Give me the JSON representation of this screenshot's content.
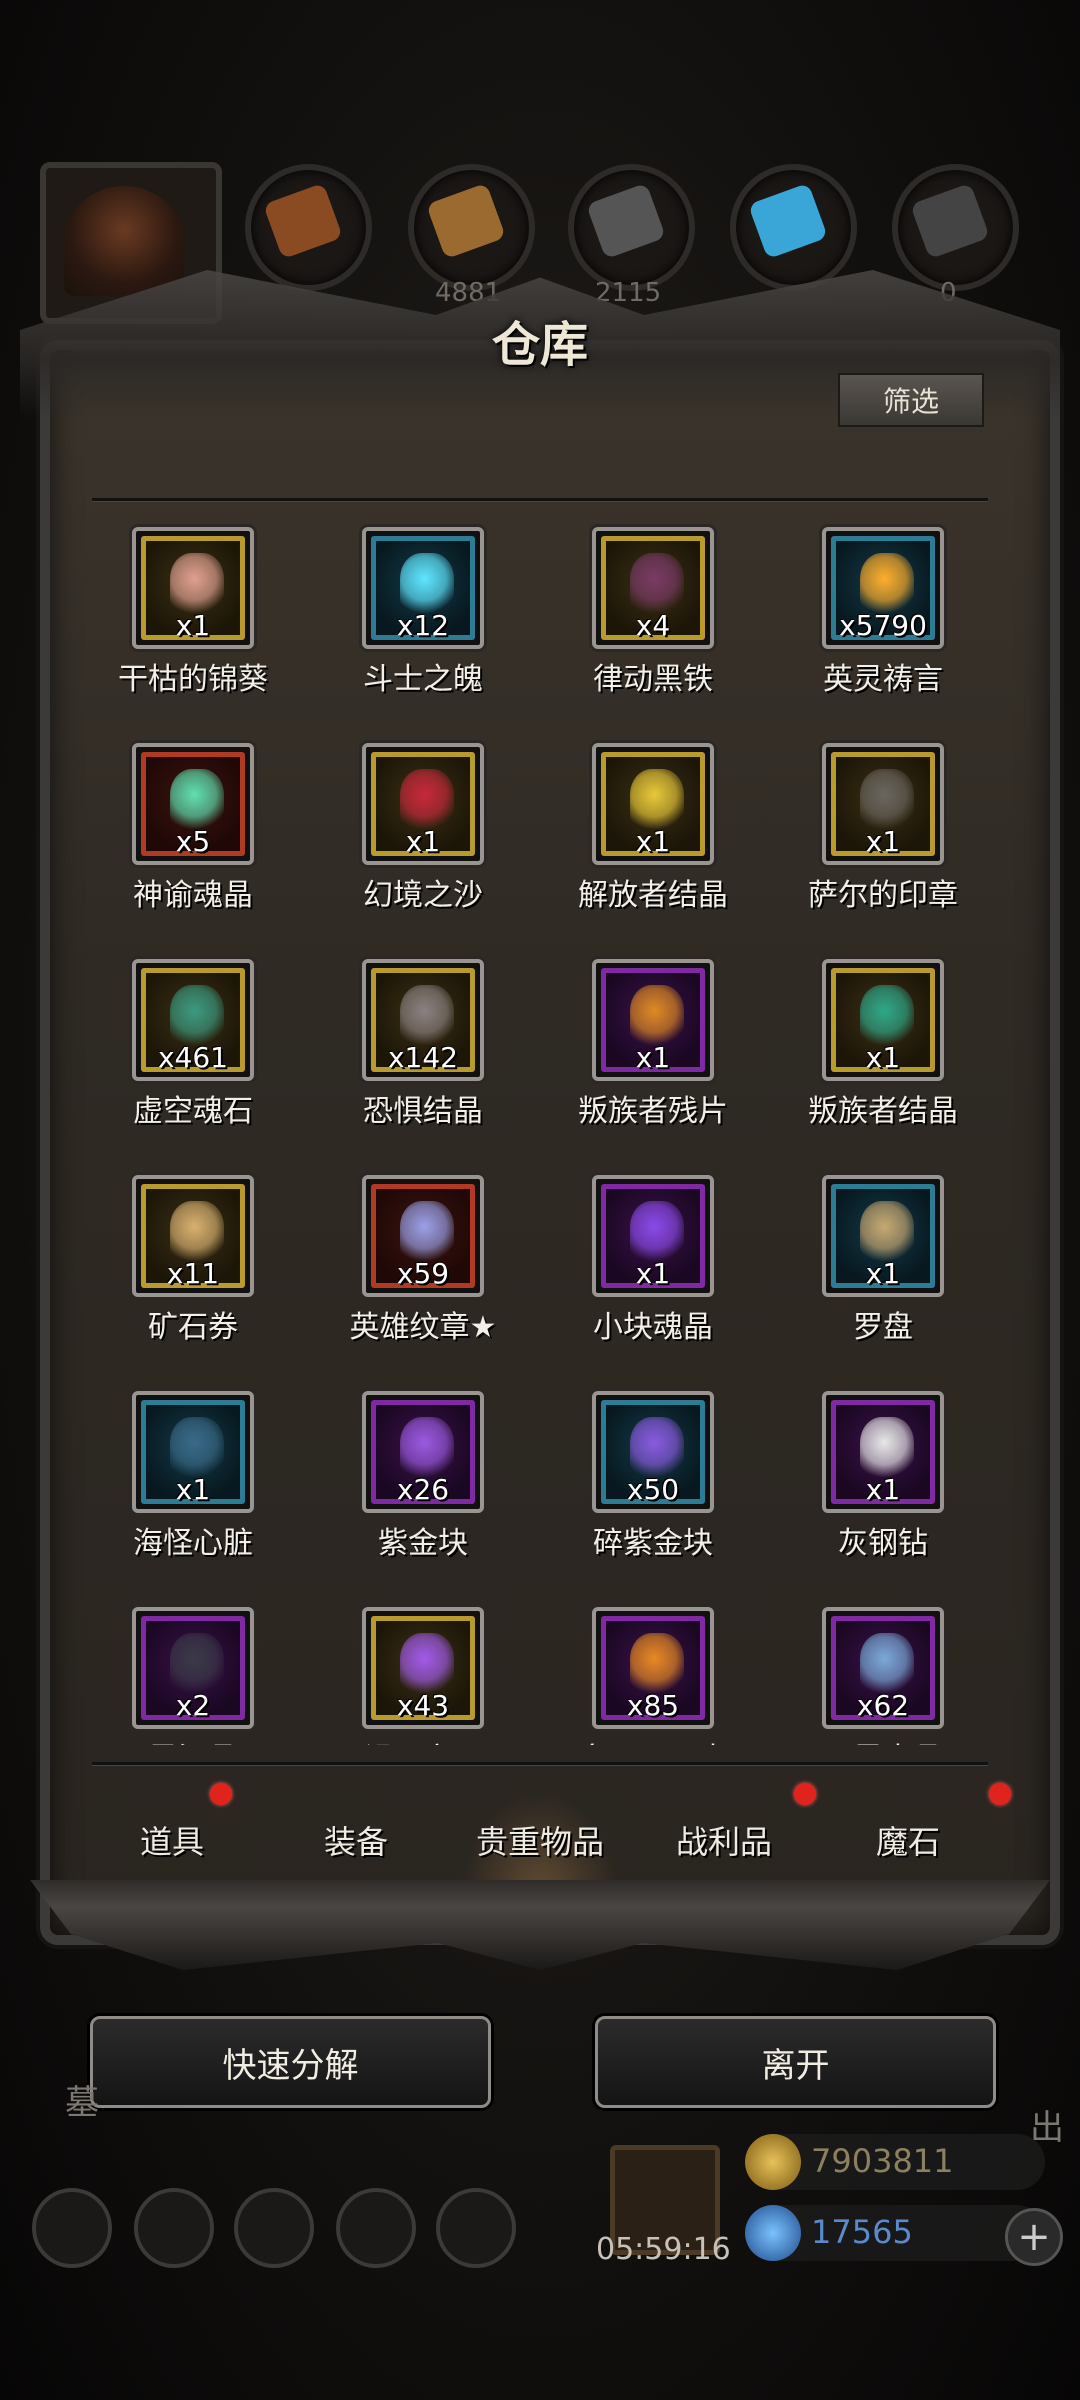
{
  "panel": {
    "title": "仓库",
    "filter_label": "筛选"
  },
  "resources": [
    {
      "icon": "wood-log-icon",
      "color": "#8a4a22",
      "count": ""
    },
    {
      "icon": "plank-icon",
      "color": "#9a6a30",
      "count": "4881"
    },
    {
      "icon": "iron-ingot-icon",
      "color": "#555555",
      "count": "2115"
    },
    {
      "icon": "crystal-icon",
      "color": "#3aa6d8",
      "count": ""
    },
    {
      "icon": "stone-icon",
      "color": "#444444",
      "count": "0"
    }
  ],
  "items": [
    {
      "name": "干枯的锦葵",
      "count": "x1",
      "rarity": "gold",
      "icon": "flower-icon",
      "color": "#e0a090"
    },
    {
      "name": "斗士之魄",
      "count": "x12",
      "rarity": "blue",
      "icon": "spirit-orb-icon",
      "color": "#5fe6ff"
    },
    {
      "name": "律动黑铁",
      "count": "x4",
      "rarity": "gold",
      "icon": "black-iron-icon",
      "color": "#7a3a66"
    },
    {
      "name": "英灵祷言",
      "count": "x5790",
      "rarity": "blue",
      "icon": "fire-orb-icon",
      "color": "#ffae2a"
    },
    {
      "name": "神谕魂晶",
      "count": "x5",
      "rarity": "red",
      "icon": "green-crystal-icon",
      "color": "#5fe0b0"
    },
    {
      "name": "幻境之沙",
      "count": "x1",
      "rarity": "gold",
      "icon": "red-sand-icon",
      "color": "#c8283a"
    },
    {
      "name": "解放者结晶",
      "count": "x1",
      "rarity": "gold",
      "icon": "gold-shard-icon",
      "color": "#e8c838"
    },
    {
      "name": "萨尔的印章",
      "count": "x1",
      "rarity": "gold",
      "icon": "shield-seal-icon",
      "color": "#6a665f"
    },
    {
      "name": "虚空魂石",
      "count": "x461",
      "rarity": "gold",
      "icon": "void-stone-icon",
      "color": "#3a9a80"
    },
    {
      "name": "恐惧结晶",
      "count": "x142",
      "rarity": "gold",
      "icon": "fear-crystal-icon",
      "color": "#8a8080"
    },
    {
      "name": "叛族者残片",
      "count": "x1",
      "rarity": "purple",
      "icon": "shard-fragment-icon",
      "color": "#e08a22"
    },
    {
      "name": "叛族者结晶",
      "count": "x1",
      "rarity": "gold",
      "icon": "teal-crystal-icon",
      "color": "#2ea88a"
    },
    {
      "name": "矿石券",
      "count": "x11",
      "rarity": "gold",
      "icon": "scroll-icon",
      "color": "#d8b070"
    },
    {
      "name": "英雄纹章★",
      "count": "x59",
      "rarity": "red",
      "icon": "hero-emblem-icon",
      "color": "#9aa0e8"
    },
    {
      "name": "小块魂晶",
      "count": "x1",
      "rarity": "purple",
      "icon": "purple-crystal-icon",
      "color": "#8a4ae8"
    },
    {
      "name": "罗盘",
      "count": "x1",
      "rarity": "blue",
      "icon": "compass-icon",
      "color": "#c8a870"
    },
    {
      "name": "海怪心脏",
      "count": "x1",
      "rarity": "blue",
      "icon": "heart-icon",
      "color": "#3a6a88"
    },
    {
      "name": "紫金块",
      "count": "x26",
      "rarity": "purple",
      "icon": "purple-gold-icon",
      "color": "#9a5ae0"
    },
    {
      "name": "碎紫金块",
      "count": "x50",
      "rarity": "blue",
      "icon": "purple-shard-icon",
      "color": "#8a5ae0"
    },
    {
      "name": "灰钢钻",
      "count": "x1",
      "rarity": "purple",
      "icon": "diamond-icon",
      "color": "#e8e8e8"
    },
    {
      "name": "黑泪晶",
      "count": "x2",
      "rarity": "purple",
      "icon": "black-tear-icon",
      "color": "#3a3a48"
    },
    {
      "name": "诅咒之石",
      "count": "x43",
      "rarity": "gold",
      "icon": "cursed-stone-icon",
      "color": "#a25ae8"
    },
    {
      "name": "多西亚灵木",
      "count": "x85",
      "rarity": "purple",
      "icon": "spirit-wood-icon",
      "color": "#e88a22"
    },
    {
      "name": "异界中晶",
      "count": "x62",
      "rarity": "purple",
      "icon": "blue-shard-icon",
      "color": "#7aaad8"
    }
  ],
  "tabs": [
    {
      "label": "道具",
      "dot": true
    },
    {
      "label": "装备",
      "dot": false
    },
    {
      "label": "贵重物品",
      "dot": true,
      "active": true
    },
    {
      "label": "战利品",
      "dot": true
    },
    {
      "label": "魔石",
      "dot": true
    }
  ],
  "buttons": {
    "decompose": "快速分解",
    "leave": "离开"
  },
  "hud": {
    "timer": "05:59:16",
    "gold": "7903811",
    "gems": "17565",
    "side_left": "墓",
    "side_right": "出"
  }
}
